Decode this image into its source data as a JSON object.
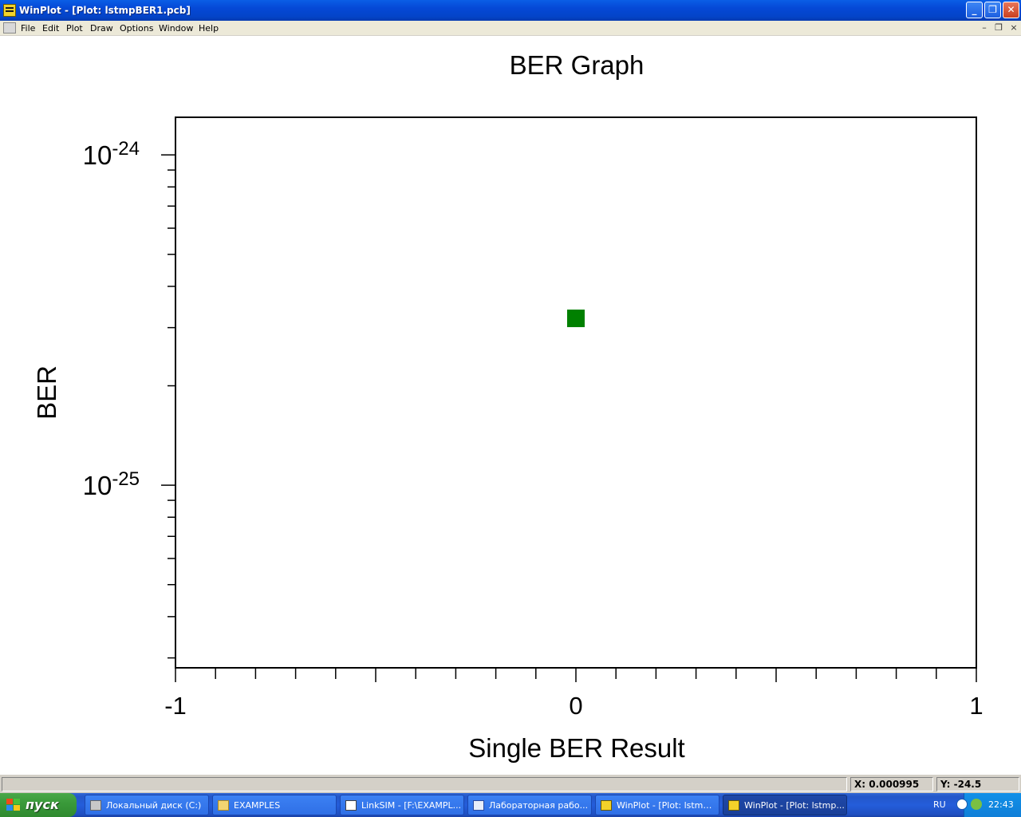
{
  "window": {
    "title": "WinPlot - [Plot: lstmpBER1.pcb]",
    "minimize_glyph": "_",
    "restore_glyph": "❐",
    "close_glyph": "✕"
  },
  "menubar": {
    "items": [
      "File",
      "Edit",
      "Plot",
      "Draw",
      "Options",
      "Window",
      "Help"
    ],
    "mdi_minimize": "–",
    "mdi_restore": "❐",
    "mdi_close": "×"
  },
  "chart_data": {
    "type": "scatter",
    "title": "BER Graph",
    "xlabel": "Single BER Result",
    "ylabel": "BER",
    "xlim": [
      -1,
      1
    ],
    "y_scale": "log",
    "ylim": [
      2.8e-26,
      1.3e-24
    ],
    "x_tick_labels": [
      "-1",
      "0",
      "1"
    ],
    "x_ticks": [
      -1,
      0,
      1
    ],
    "y_major_ticks": [
      {
        "value": 1e-24,
        "base": "10",
        "exponent": "-24"
      },
      {
        "value": 1e-25,
        "base": "10",
        "exponent": "-25"
      }
    ],
    "points": [
      {
        "x": 0,
        "y": 3.2e-25
      }
    ],
    "marker": "square",
    "marker_color": "#008000",
    "grid": false
  },
  "statusbar": {
    "x_readout": "X: 0.000995",
    "y_readout": "Y: -24.5"
  },
  "taskbar": {
    "start_label": "пуск",
    "tasks": [
      {
        "label": "Локальный диск (C:)",
        "icon": "drive-icon"
      },
      {
        "label": "EXAMPLES",
        "icon": "folder-icon"
      },
      {
        "label": "LinkSIM - [F:\\EXAMPL...",
        "icon": "window-icon"
      },
      {
        "label": "Лабораторная рабо...",
        "icon": "word-doc-icon"
      },
      {
        "label": "WinPlot - [Plot: lstmpr...",
        "icon": "winplot-icon"
      },
      {
        "label": "WinPlot - [Plot: lstmp...",
        "icon": "winplot-icon",
        "active": true
      }
    ],
    "language": "RU",
    "clock": "22:43"
  },
  "colors": {
    "title_bar": "#0548d6",
    "marker": "#008000",
    "taskbar": "#245dda",
    "start_button": "#3a9a3a"
  }
}
